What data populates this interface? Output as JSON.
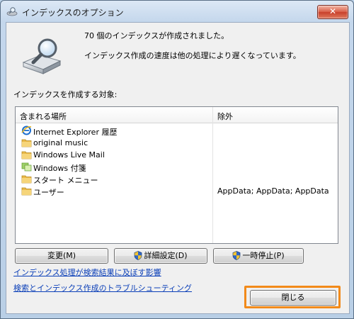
{
  "window": {
    "title": "インデックスのオプション",
    "close_glyph": "✕"
  },
  "summary": {
    "count_text": "70 個のインデックスが作成されました。",
    "speed_text": "インデックス作成の速度は他の処理により遅くなっています。"
  },
  "section_label": "インデックスを作成する対象:",
  "list": {
    "columns": [
      "含まれる場所",
      "除外"
    ],
    "rows": [
      {
        "name": "Internet Explorer 履歴",
        "exclude": "",
        "icon": "internet-explorer-icon"
      },
      {
        "name": "original music",
        "exclude": "",
        "icon": "folder-icon"
      },
      {
        "name": "Windows Live Mail",
        "exclude": "",
        "icon": "folder-icon"
      },
      {
        "name": "Windows 付箋",
        "exclude": "",
        "icon": "sticky-notes-icon"
      },
      {
        "name": "スタート メニュー",
        "exclude": "",
        "icon": "folder-icon"
      },
      {
        "name": "ユーザー",
        "exclude": "AppData; AppData; AppData",
        "icon": "folder-icon"
      }
    ]
  },
  "buttons": {
    "modify": "変更(M)",
    "advanced": "詳細設定(D)",
    "pause": "一時停止(P)",
    "close": "閉じる"
  },
  "links": {
    "impact": "インデックス処理が検索結果に及ぼす影響",
    "troubleshoot": "検索とインデックス作成のトラブルシューティング"
  },
  "colors": {
    "link": "#0b3fb8",
    "highlight": "#f28a1a",
    "close_button": "#c8412c"
  }
}
